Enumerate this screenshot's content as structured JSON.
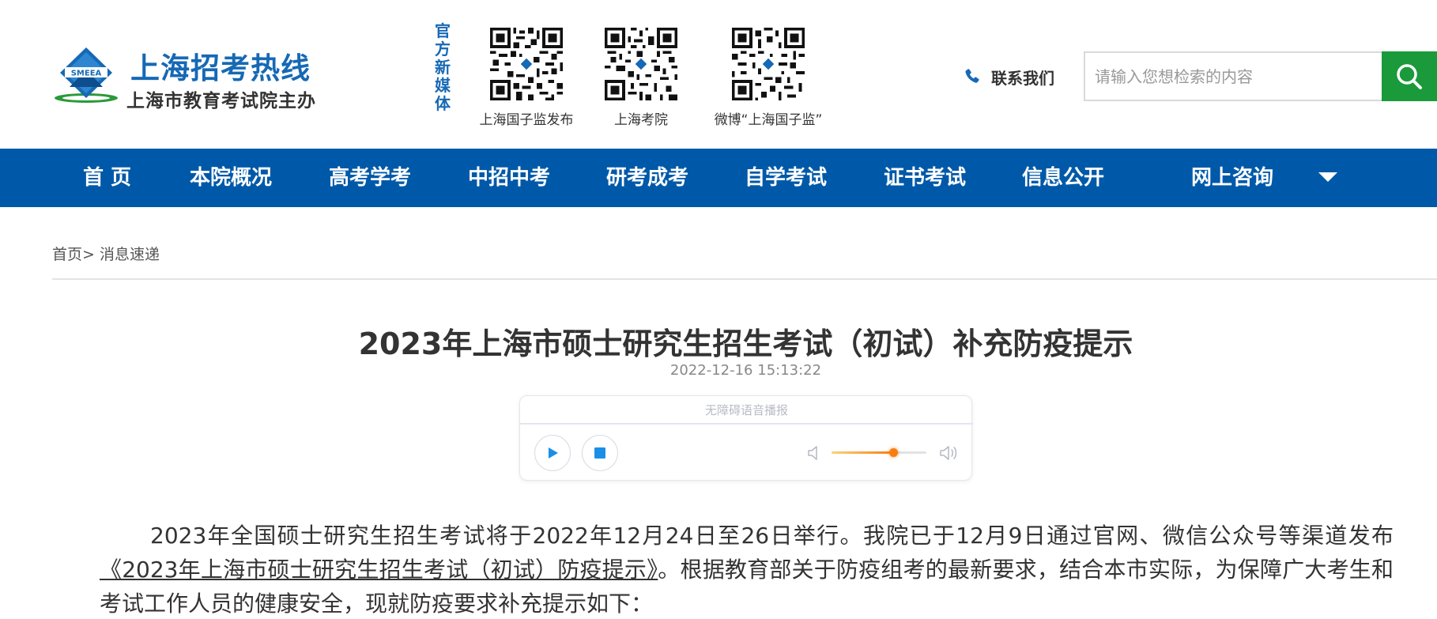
{
  "header": {
    "logo": {
      "badge_text": "SMEEA",
      "title": "上海招考热线",
      "subtitle": "上海市教育考试院主办"
    },
    "media_label": "官方新媒体",
    "qr_codes": [
      {
        "label": "上海国子监发布"
      },
      {
        "label": "上海考院"
      },
      {
        "label": "微博“上海国子监”"
      }
    ],
    "contact_label": "联系我们",
    "search": {
      "placeholder": "请输入您想检索的内容",
      "button_icon": "search-icon"
    }
  },
  "nav": {
    "items": [
      {
        "label": "首 页"
      },
      {
        "label": "本院概况"
      },
      {
        "label": "高考学考"
      },
      {
        "label": "中招中考"
      },
      {
        "label": "研考成考"
      },
      {
        "label": "自学考试"
      },
      {
        "label": "证书考试"
      },
      {
        "label": "信息公开"
      },
      {
        "label": "网上咨询"
      }
    ],
    "more_icon": "caret-down-icon"
  },
  "breadcrumb": {
    "home": "首页",
    "separator": ">",
    "current": "消息速递"
  },
  "article": {
    "title": "2023年上海市硕士研究生招生考试（初试）补充防疫提示",
    "date": "2022-12-16 15:13:22",
    "audio_player": {
      "label": "无障碍语音播报",
      "volume_percent": 65
    },
    "body": {
      "part1": "2023年全国硕士研究生招生考试将于2022年12月24日至26日举行。我院已于12月9日通过官网、微信公众号等渠道发布",
      "link": "《2023年上海市硕士研究生招生考试（初试）防疫提示》",
      "part2": "。根据教育部关于防疫组考的最新要求，结合本市实际，为保障广大考生和考试工作人员的健康安全，现就防疫要求补充提示如下："
    }
  },
  "colors": {
    "brand_blue": "#0059a8",
    "logo_blue": "#1669b5",
    "search_green": "#1a9a3a",
    "volume_orange": "#f77d12"
  }
}
